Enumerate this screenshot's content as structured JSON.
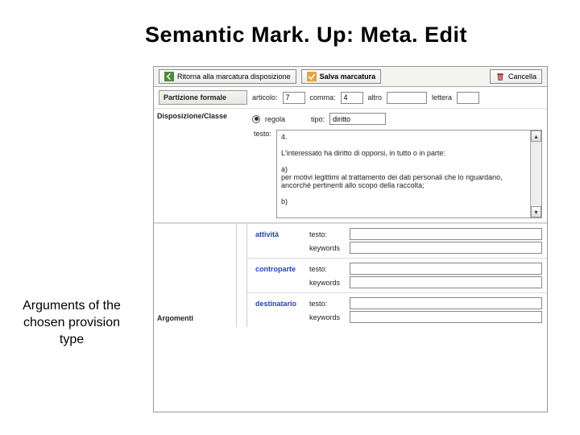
{
  "title": "Semantic Mark. Up: Meta. Edit",
  "annotation": "Arguments of the chosen provision type",
  "toolbar": {
    "back": "Ritorna alla marcatura disposizione",
    "save": "Salva marcatura",
    "cancel": "Cancella"
  },
  "partizione": {
    "label": "Partizione formale",
    "articolo_lbl": "articolo:",
    "articolo_val": "7",
    "comma_lbl": "comma:",
    "comma_val": "4",
    "altro_lbl": "altro",
    "lettera_lbl": "lettera"
  },
  "regola": {
    "radio_lbl": "regola",
    "tipo_lbl": "tipo:",
    "tipo_val": "diritto"
  },
  "disposizione": {
    "label": "Disposizione/Classe",
    "testo_lbl": "testo:",
    "body": "4.\n\nL'interessato ha diritto di opporsi, in tutto o in parte:\n\na)\nper motivi legittimi al trattamento dei dati personali che lo riguardano, ancorché pertinenti allo scopo della raccolta;\n\nb)"
  },
  "args": {
    "attivita": "attività",
    "controparte": "controparte",
    "destinatario": "destinatario",
    "testo_lbl": "testo:",
    "keywords_lbl": "keywords",
    "argomenti": "Argomenti"
  }
}
